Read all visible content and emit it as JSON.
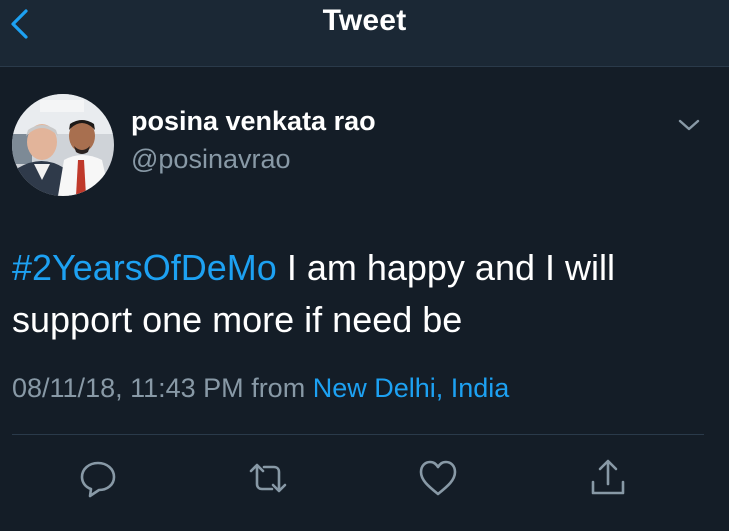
{
  "header": {
    "title": "Tweet",
    "back_icon": "chevron-left-icon"
  },
  "tweet": {
    "author_name": "posina venkata rao",
    "author_handle": "@posinavrao",
    "hashtag": "#2YearsOfDeMo",
    "text_line1": " I am happy and I will",
    "text_line2": "support one more if need be",
    "timestamp": "08/11/18, 11:43 PM",
    "from_label": "from",
    "location": "New Delhi, India",
    "options_icon": "chevron-down-icon"
  },
  "actions": {
    "reply_icon": "reply-icon",
    "retweet_icon": "retweet-icon",
    "like_icon": "heart-icon",
    "share_icon": "share-icon"
  },
  "colors": {
    "background": "#141d27",
    "header_background": "#1b2835",
    "accent": "#1da1f2",
    "secondary_text": "#8899a6",
    "divider": "#2a3a4a"
  }
}
